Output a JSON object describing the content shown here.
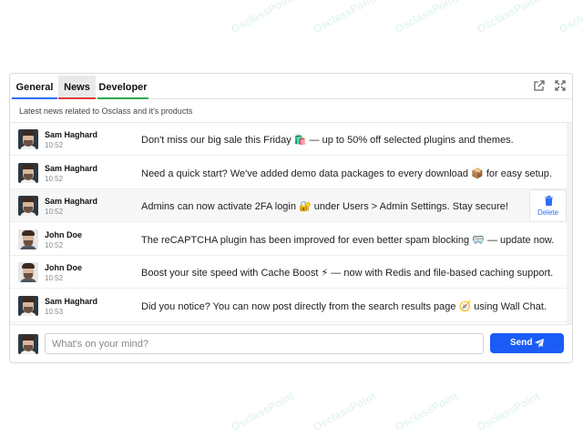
{
  "watermark": "OsclassPoint",
  "tabs": [
    {
      "label": "General"
    },
    {
      "label": "News"
    },
    {
      "label": "Developer"
    }
  ],
  "subtitle": "Latest news related to Osclass and it's products",
  "icons": {
    "external": "external-link-icon",
    "expand": "expand-icon",
    "trash": "trash-icon",
    "send": "paper-plane-icon"
  },
  "messages": [
    {
      "author": "Sam Haghard",
      "time": "10:52",
      "text": "Don't miss our big sale this Friday 🛍️ — up to 50% off selected plugins and themes.",
      "avatar": "dark"
    },
    {
      "author": "Sam Haghard",
      "time": "10:52",
      "text": "Need a quick start? We've added demo data packages to every download 📦 for easy setup.",
      "avatar": "dark"
    },
    {
      "author": "Sam Haghard",
      "time": "10:52",
      "text": "Admins can now activate 2FA login 🔐 under Users > Admin Settings. Stay secure!",
      "avatar": "dark"
    },
    {
      "author": "John Doe",
      "time": "10:52",
      "text": "The reCAPTCHA plugin has been improved for even better spam blocking 🥽 — update now.",
      "avatar": "light"
    },
    {
      "author": "John Doe",
      "time": "10:52",
      "text": "Boost your site speed with Cache Boost ⚡ — now with Redis and file-based caching support.",
      "avatar": "light"
    },
    {
      "author": "Sam Haghard",
      "time": "10:53",
      "text": "Did you notice? You can now post directly from the search results page 🧭 using Wall Chat.",
      "avatar": "dark"
    }
  ],
  "delete_label": "Delete",
  "composer": {
    "placeholder": "What's on your mind?",
    "send_label": "Send"
  },
  "colors": {
    "accent": "#1a5cf5",
    "tab_general": "#2f6df6",
    "tab_news": "#e03a3a",
    "tab_developer": "#2ea84b"
  }
}
